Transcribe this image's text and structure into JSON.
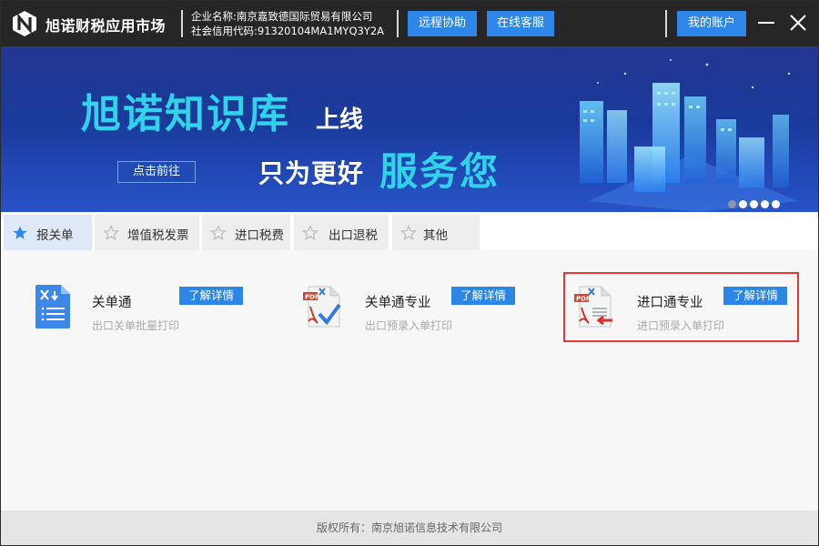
{
  "titlebar": {
    "app_title": "旭诺财税应用市场",
    "company_name": "企业名称:南京嘉致德国际贸易有限公司",
    "credit_code": "社会信用代码:91320104MA1MYQ3Y2A",
    "remote_label": "远程协助",
    "service_label": "在线客服",
    "account_label": "我的账户",
    "icons": {
      "logo": "app-logo-icon",
      "minimize": "minimize-icon",
      "close": "close-icon"
    }
  },
  "banner": {
    "title": "旭诺知识库",
    "title_suffix": "上线",
    "subtitle_part1": "只为更好",
    "subtitle_part2": "服务您",
    "cta_label": "点击前往",
    "slide_count": 5,
    "active_slide": 1,
    "colors": {
      "accent": "#30d3ea",
      "background": "#1a3a9b"
    }
  },
  "tabs": [
    {
      "label": "报关单",
      "active": true,
      "icon": "star-filled-icon"
    },
    {
      "label": "增值税发票",
      "active": false,
      "icon": "star-outline-icon"
    },
    {
      "label": "进口税费",
      "active": false,
      "icon": "star-outline-icon"
    },
    {
      "label": "出口退税",
      "active": false,
      "icon": "star-outline-icon"
    },
    {
      "label": "其他",
      "active": false,
      "icon": "star-outline-icon"
    }
  ],
  "apps": [
    {
      "name": "关单通",
      "desc": "出口关单批量打印",
      "button": "了解详情",
      "icon": "document-tools-icon"
    },
    {
      "name": "关单通专业",
      "desc": "出口预录入单打印",
      "button": "了解详情",
      "icon": "pdf-check-icon"
    },
    {
      "name": "进口通专业",
      "desc": "进口预录入单打印",
      "button": "了解详情",
      "icon": "pdf-import-icon",
      "highlighted": true
    }
  ],
  "footer": {
    "copyright": "版权所有：南京旭诺信息技术有限公司"
  },
  "colors": {
    "titlebar": "#262626",
    "button_blue": "#2e86e8",
    "highlight_red": "#e53535"
  }
}
